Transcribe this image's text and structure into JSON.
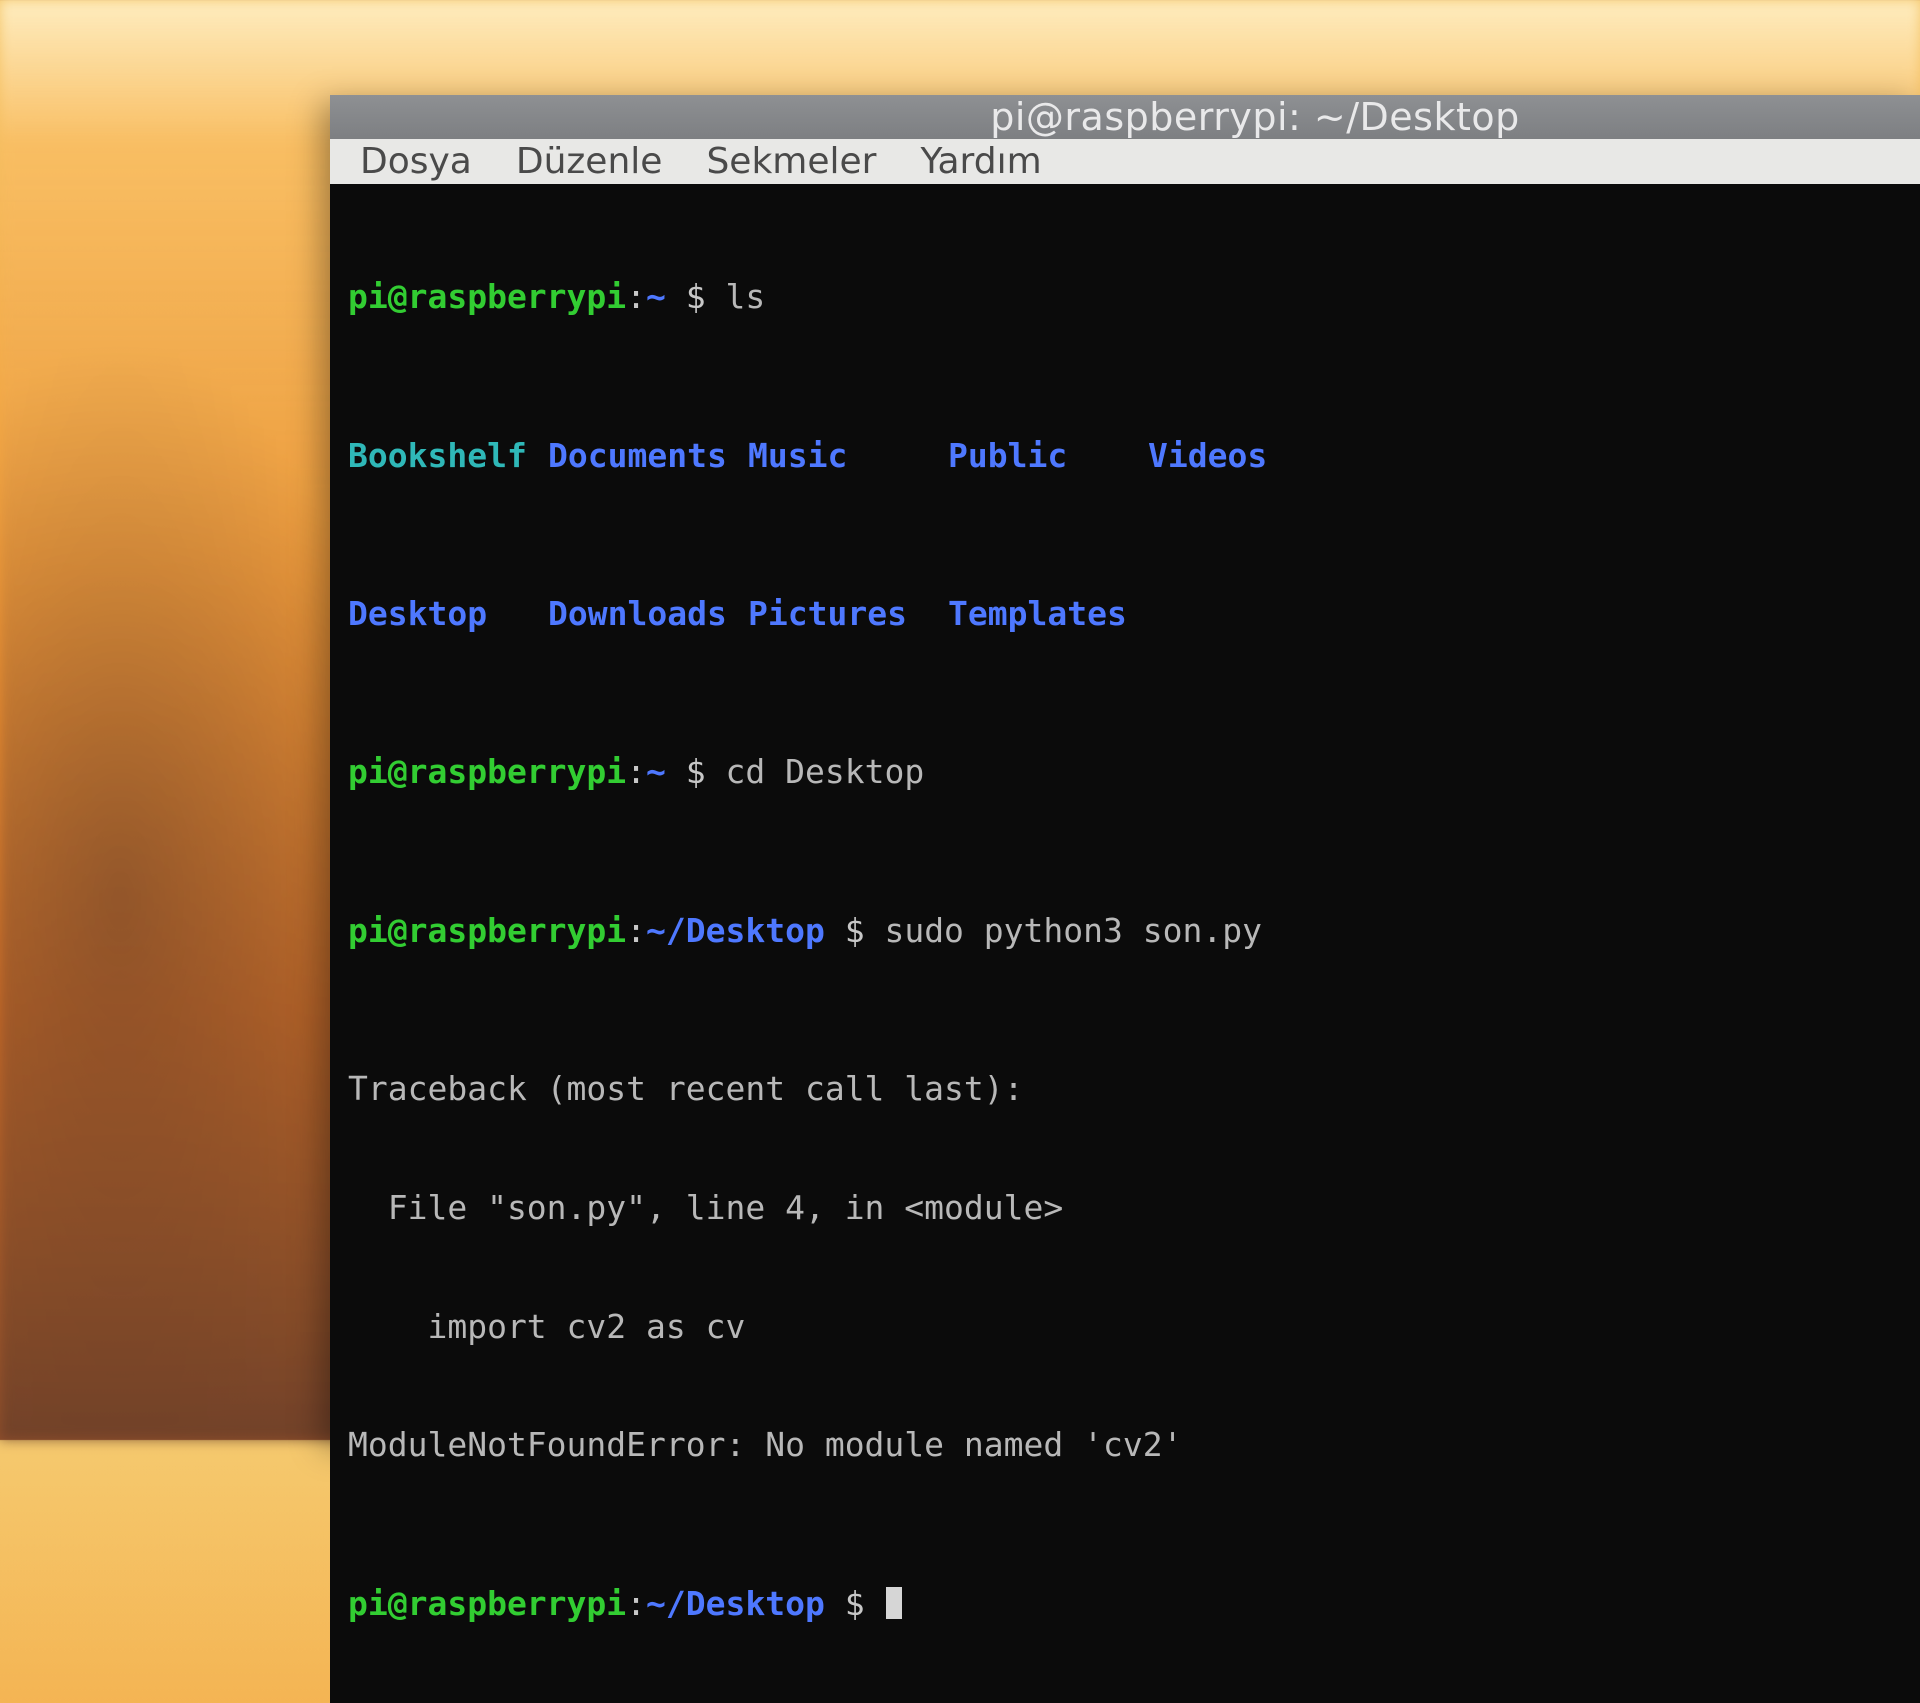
{
  "window": {
    "title": "pi@raspberrypi: ~/Desktop"
  },
  "menu": {
    "file": "Dosya",
    "edit": "Düzenle",
    "tabs": "Sekmeler",
    "help": "Yardım"
  },
  "prompt": {
    "user_host": "pi@raspberrypi",
    "sep": ":",
    "home_path": "~",
    "desktop_path": "~/Desktop",
    "dollar": " $ "
  },
  "commands": {
    "ls": "ls",
    "cd": "cd Desktop",
    "run": "sudo python3 son.py"
  },
  "ls_output": {
    "row1": {
      "c1": "Bookshelf",
      "c2": "Documents",
      "c3": "Music",
      "c4": "Public",
      "c5": "Videos"
    },
    "row2": {
      "c1": "Desktop",
      "c2": "Downloads",
      "c3": "Pictures",
      "c4": "Templates",
      "c5": ""
    }
  },
  "traceback": {
    "l1": "Traceback (most recent call last):",
    "l2": "  File \"son.py\", line 4, in <module>",
    "l3": "    import cv2 as cv",
    "l4": "ModuleNotFoundError: No module named 'cv2'"
  }
}
